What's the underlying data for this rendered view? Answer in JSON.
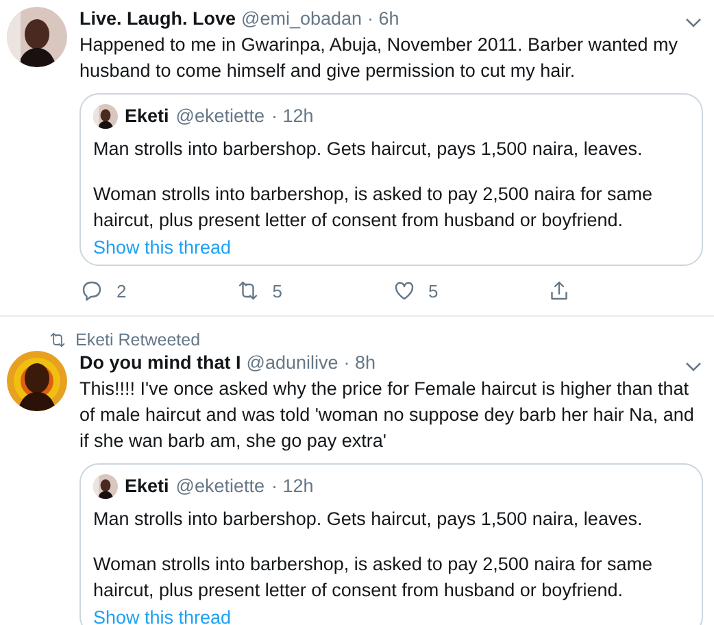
{
  "tweets": [
    {
      "author": {
        "name": "Live. Laugh. Love",
        "handle": "@emi_obadan",
        "time": "· 6h"
      },
      "text": "Happened to me in Gwarinpa, Abuja, November 2011. Barber wanted my husband to come himself and give permission to cut my hair.",
      "quote": {
        "name": "Eketi",
        "handle": "@eketiette",
        "time": "· 12h",
        "paragraphs": [
          "Man strolls into barbershop. Gets haircut, pays 1,500 naira, leaves.",
          "Woman strolls into barbershop, is asked to pay 2,500 naira for same haircut, plus present letter of consent from husband or boyfriend."
        ],
        "link": "Show this thread"
      },
      "actions": {
        "replies": "2",
        "retweets": "5",
        "likes": "5"
      }
    },
    {
      "social_context": "Eketi Retweeted",
      "author": {
        "name": "Do you mind that I",
        "handle": "@adunilive",
        "time": "· 8h"
      },
      "text": "This!!!! I've once asked why the price for Female haircut is higher than that of male haircut and was told 'woman no suppose dey barb her hair Na, and if she wan barb am, she go pay extra'",
      "quote": {
        "name": "Eketi",
        "handle": "@eketiette",
        "time": "· 12h",
        "paragraphs": [
          "Man strolls into barbershop. Gets haircut, pays 1,500 naira, leaves.",
          "Woman strolls into barbershop, is asked to pay 2,500 naira for same haircut, plus present letter of consent from husband or boyfriend."
        ],
        "link": "Show this thread"
      }
    }
  ]
}
